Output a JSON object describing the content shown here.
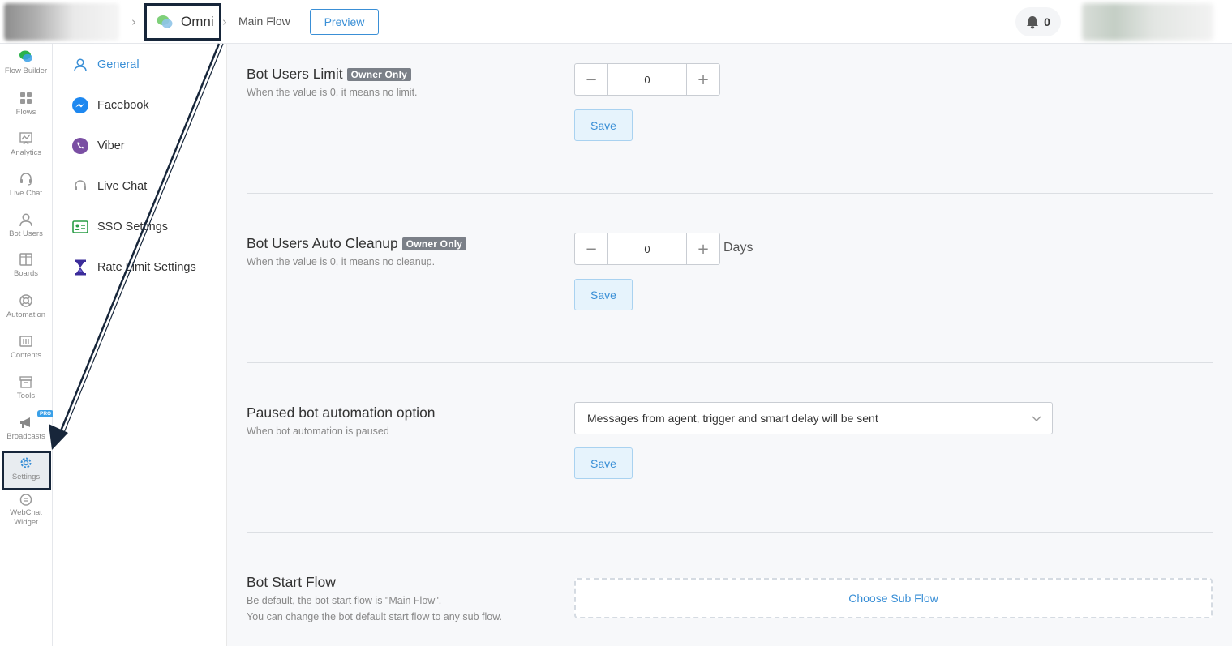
{
  "header": {
    "bot_name": "Omni",
    "flow_name": "Main Flow",
    "preview_label": "Preview",
    "notification_count": "0"
  },
  "leftnav": {
    "items": [
      {
        "label": "Flow Builder",
        "icon": "flow-builder-icon"
      },
      {
        "label": "Flows",
        "icon": "grid-icon"
      },
      {
        "label": "Analytics",
        "icon": "chart-icon"
      },
      {
        "label": "Live Chat",
        "icon": "headset-icon"
      },
      {
        "label": "Bot Users",
        "icon": "user-icon"
      },
      {
        "label": "Boards",
        "icon": "board-icon"
      },
      {
        "label": "Automation",
        "icon": "lifebuoy-icon"
      },
      {
        "label": "Contents",
        "icon": "contents-icon"
      },
      {
        "label": "Tools",
        "icon": "box-icon"
      },
      {
        "label": "Broadcasts",
        "icon": "megaphone-icon",
        "badge": "PRO"
      },
      {
        "label": "Settings",
        "icon": "gear-icon"
      },
      {
        "label1": "WebChat",
        "label2": "Widget",
        "icon": "chat-bubble-icon"
      }
    ]
  },
  "subnav": {
    "items": [
      {
        "label": "General",
        "icon": "user-outline-icon"
      },
      {
        "label": "Facebook",
        "icon": "messenger-icon"
      },
      {
        "label": "Viber",
        "icon": "viber-icon"
      },
      {
        "label": "Live Chat",
        "icon": "headset-icon"
      },
      {
        "label": "SSO Settings",
        "icon": "id-card-icon"
      },
      {
        "label": "Rate Limit Settings",
        "icon": "hourglass-icon"
      }
    ]
  },
  "sections": {
    "limit": {
      "title": "Bot Users Limit",
      "badge": "Owner Only",
      "desc": "When the value is 0, it means no limit.",
      "value": "0",
      "save": "Save"
    },
    "cleanup": {
      "title": "Bot Users Auto Cleanup",
      "badge": "Owner Only",
      "desc": "When the value is 0, it means no cleanup.",
      "value": "0",
      "unit": "Days",
      "save": "Save"
    },
    "paused": {
      "title": "Paused bot automation option",
      "desc": "When bot automation is paused",
      "selected": "Messages from agent, trigger and smart delay will be sent",
      "save": "Save"
    },
    "start_flow": {
      "title": "Bot Start Flow",
      "desc1": "Be default, the bot start flow is \"Main Flow\".",
      "desc2": "You can change the bot default start flow to any sub flow.",
      "choose": "Choose Sub Flow"
    }
  },
  "colors": {
    "accent": "#3a8fd6",
    "annotation": "#17263a"
  }
}
